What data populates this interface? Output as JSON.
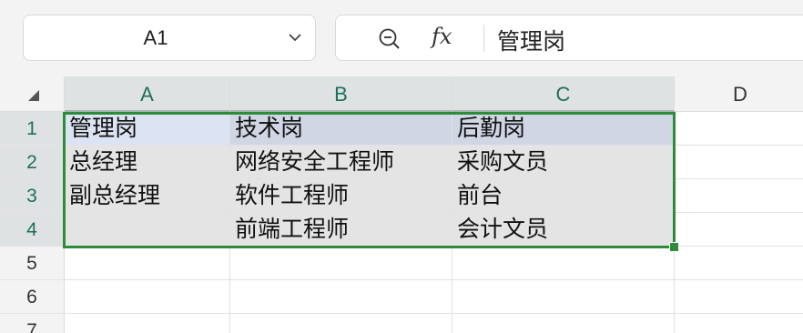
{
  "name_box": {
    "value": "A1"
  },
  "formula_bar": {
    "content": "管理岗"
  },
  "icons": {
    "name_box_dropdown": "chevron-down-icon",
    "zoom": "zoom-out-icon",
    "fx": "fx-icon"
  },
  "grid": {
    "columns": [
      "A",
      "B",
      "C",
      "D"
    ],
    "rows": [
      "1",
      "2",
      "3",
      "4",
      "5",
      "6",
      "7"
    ],
    "cells": [
      [
        "管理岗",
        "技术岗",
        "后勤岗"
      ],
      [
        "总经理",
        "网络安全工程师",
        "采购文员"
      ],
      [
        "副总经理",
        "软件工程师",
        "前台"
      ],
      [
        "",
        "前端工程师",
        "会计文员"
      ]
    ]
  },
  "colors": {
    "selection_border": "#2e8b3a",
    "selected_header_text": "#1e6f5c",
    "header_row_fill": "#d0d6e4"
  },
  "fx_label": "fx"
}
